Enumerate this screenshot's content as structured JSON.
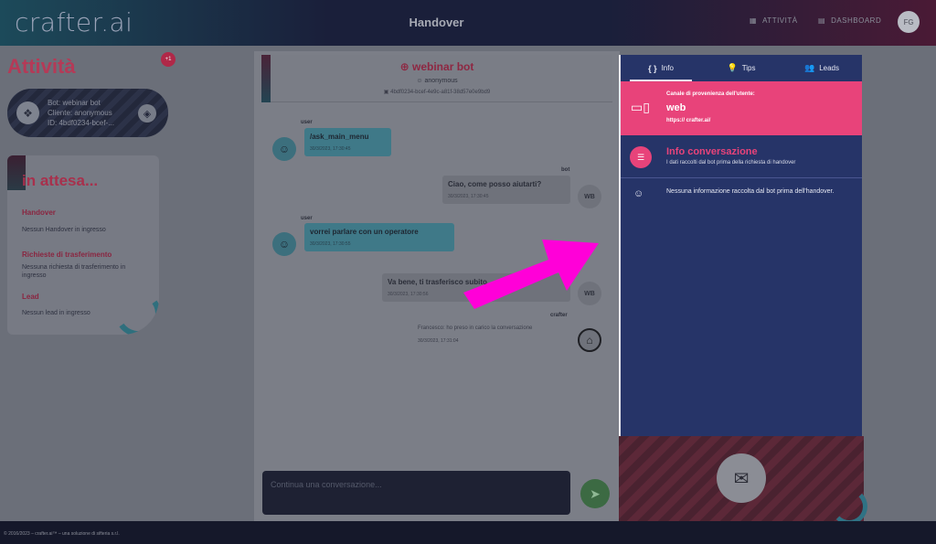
{
  "topbar": {
    "logo": "crafter.ai",
    "title": "Handover",
    "nav": [
      {
        "icon": "activity-icon",
        "label": "ATTIVITÀ"
      },
      {
        "icon": "dashboard-icon",
        "label": "DASHBOARD"
      }
    ],
    "avatar": "FG"
  },
  "left": {
    "title": "Attività",
    "badge": "+1",
    "bot_card": {
      "bot": "Bot: webinar bot",
      "client": "Cliente: anonymous",
      "id": "ID: 4bdf0234-bcef-..."
    },
    "waiting": {
      "title": "in attesa...",
      "sections": [
        {
          "heading": "Handover",
          "text": "Nessun Handover in ingresso"
        },
        {
          "heading": "Richieste di trasferimento",
          "text": "Nessuna richiesta di trasferimento in ingresso"
        },
        {
          "heading": "Lead",
          "text": "Nessun lead in ingresso"
        }
      ]
    }
  },
  "chat": {
    "title": "⊕ webinar bot",
    "subtitle": "☺ anonymous",
    "id": "▣ 4bdf0234-bcef-4e9c-a81f-38d57e0e9bd9",
    "messages": [
      {
        "sender": "user",
        "text": "/ask_main_menu",
        "meta": "30/3/2023, 17:30:45"
      },
      {
        "sender": "bot",
        "text": "Ciao, come posso aiutarti?",
        "meta": "30/3/2023, 17:30:45"
      },
      {
        "sender": "user",
        "text": "vorrei parlare con un operatore",
        "meta": "30/3/2023, 17:30:55"
      },
      {
        "sender": "bot",
        "text": "Va bene, ti trasferisco subito...",
        "meta": "30/3/2023, 17:30:56"
      }
    ],
    "bot_avatar": "WB",
    "system": {
      "sender": "crafter",
      "text": "Francesco: ho preso in carico la conversazione",
      "meta": "30/3/2023, 17:31:04"
    },
    "input_placeholder": "Continua una conversazione..."
  },
  "panel": {
    "tabs": [
      {
        "icon": "{ }",
        "label": "Info"
      },
      {
        "icon": "💡",
        "label": "Tips"
      },
      {
        "icon": "👥",
        "label": "Leads"
      }
    ],
    "channel": {
      "label": "Canale di provenienza dell'utente:",
      "value": "web",
      "url": "https:// crafter.ai/"
    },
    "info_conversation": {
      "heading": "Info conversazione",
      "text": "I dati raccolti dal bot prima della richiesta di handover"
    },
    "no_info": "Nessuna informazione raccolta dal bot prima dell'handover."
  },
  "footer": "© 2016/2023 – crafter.ai™ – una soluzione di sifteria s.r.l.",
  "colors": {
    "accent_pink": "#e8437a",
    "panel_navy": "#263468",
    "highlight_arrow": "#ff00d8"
  }
}
